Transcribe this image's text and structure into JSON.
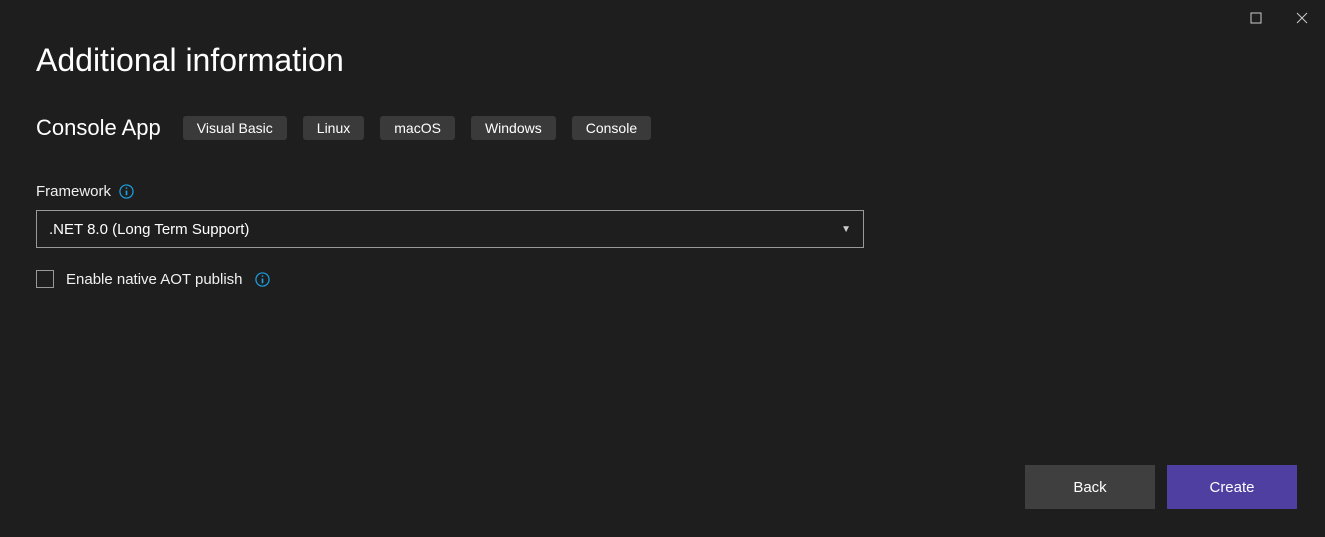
{
  "header": {
    "title": "Additional information"
  },
  "project": {
    "name": "Console App",
    "tags": [
      "Visual Basic",
      "Linux",
      "macOS",
      "Windows",
      "Console"
    ]
  },
  "framework": {
    "label": "Framework",
    "selected": ".NET 8.0 (Long Term Support)"
  },
  "aot": {
    "label": "Enable native AOT publish",
    "checked": false
  },
  "footer": {
    "back": "Back",
    "create": "Create"
  }
}
